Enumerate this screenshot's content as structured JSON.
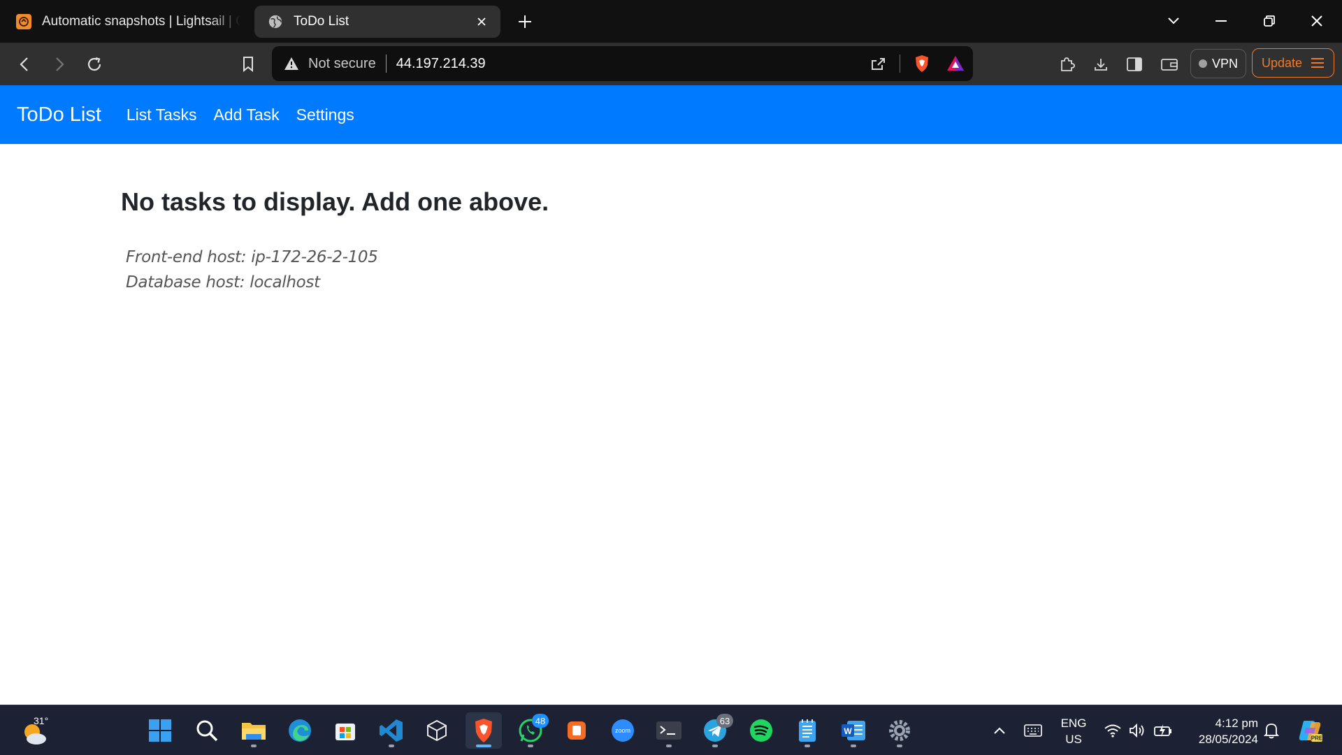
{
  "browser": {
    "tabs": [
      {
        "title": "Automatic snapshots | Lightsail | Global",
        "favicon": "lightsail-icon",
        "active": false
      },
      {
        "title": "ToDo List",
        "favicon": "globe-icon",
        "active": true
      }
    ],
    "address_bar": {
      "security_text": "Not secure",
      "url": "44.197.214.39"
    },
    "vpn_label": "VPN",
    "update_label": "Update",
    "colors": {
      "tabstrip": "#111111",
      "toolbar": "#303030",
      "update_accent": "#f07a2c"
    }
  },
  "page": {
    "navbar": {
      "brand": "ToDo List",
      "links": [
        "List Tasks",
        "Add Task",
        "Settings"
      ],
      "color": "#007bff"
    },
    "heading": "No tasks to display. Add one above.",
    "frontend_host": "Front-end host: ip-172-26-2-105",
    "database_host": "Database host: localhost"
  },
  "taskbar": {
    "weather_temp": "31°",
    "apps": [
      {
        "name": "start",
        "icon": "windows-start-icon"
      },
      {
        "name": "search",
        "icon": "search-icon"
      },
      {
        "name": "file-explorer",
        "icon": "folder-icon"
      },
      {
        "name": "edge",
        "icon": "edge-icon"
      },
      {
        "name": "store",
        "icon": "store-icon"
      },
      {
        "name": "vscode",
        "icon": "vscode-icon"
      },
      {
        "name": "virtualbox",
        "icon": "cube-icon"
      },
      {
        "name": "brave",
        "icon": "brave-icon"
      },
      {
        "name": "whatsapp",
        "icon": "whatsapp-icon",
        "badge": "48"
      },
      {
        "name": "office",
        "icon": "office-icon"
      },
      {
        "name": "zoom",
        "icon": "zoom-icon",
        "label": "zoom"
      },
      {
        "name": "terminal",
        "icon": "terminal-icon"
      },
      {
        "name": "telegram",
        "icon": "telegram-icon",
        "badge": "63"
      },
      {
        "name": "spotify",
        "icon": "spotify-icon"
      },
      {
        "name": "notepad",
        "icon": "notepad-icon"
      },
      {
        "name": "word",
        "icon": "word-icon",
        "label": "W"
      },
      {
        "name": "settings",
        "icon": "gear-icon"
      }
    ],
    "language": {
      "line1": "ENG",
      "line2": "US"
    },
    "time": "4:12 pm",
    "date": "28/05/2024",
    "copilot_label": "PRE"
  }
}
